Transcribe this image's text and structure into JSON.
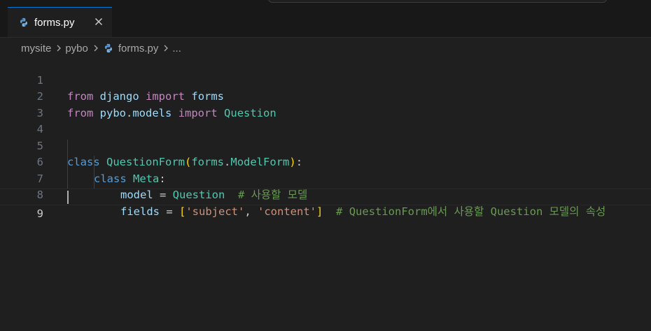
{
  "editor_tab": {
    "label": "forms.py",
    "file_icon": "python-file-icon",
    "close_icon": "close-icon"
  },
  "breadcrumb": {
    "items": [
      "mysite",
      "pybo",
      "forms.py",
      "..."
    ],
    "separator_icon": "chevron-right-icon"
  },
  "colors": {
    "accent": "#0078d4",
    "keyword": "#569cd6",
    "import_keyword": "#c586c0",
    "class_name": "#4ec9b0",
    "variable": "#9cdcfe",
    "string": "#ce9178",
    "comment": "#6a9955"
  },
  "code": {
    "line_numbers": [
      "1",
      "2",
      "3",
      "4",
      "5",
      "6",
      "7",
      "8",
      "9"
    ],
    "active_line": "9",
    "line1": {
      "t1": "from",
      "t2": " ",
      "t3": "django",
      "t4": " ",
      "t5": "import",
      "t6": " ",
      "t7": "forms"
    },
    "line2": {
      "t1": "from",
      "t2": " ",
      "t3": "pybo",
      "t4": ".",
      "t5": "models",
      "t6": " ",
      "t7": "import",
      "t8": " ",
      "t9": "Question"
    },
    "line5": {
      "t1": "class",
      "t2": " ",
      "t3": "QuestionForm",
      "t4": "(",
      "t5": "forms",
      "t6": ".",
      "t7": "ModelForm",
      "t8": ")",
      "t9": ":"
    },
    "line6": {
      "t1": "class",
      "t2": " ",
      "t3": "Meta",
      "t4": ":"
    },
    "line7": {
      "t1": "model",
      "t2": " = ",
      "t3": "Question",
      "t4": "  ",
      "t5": "# 사용할 모델"
    },
    "line8": {
      "t1": "fields",
      "t2": " = ",
      "t3": "[",
      "t4": "'subject'",
      "t5": ", ",
      "t6": "'content'",
      "t7": "]",
      "t8": "  ",
      "t9": "# QuestionForm에서 사용할 Question 모델의 속성"
    }
  }
}
